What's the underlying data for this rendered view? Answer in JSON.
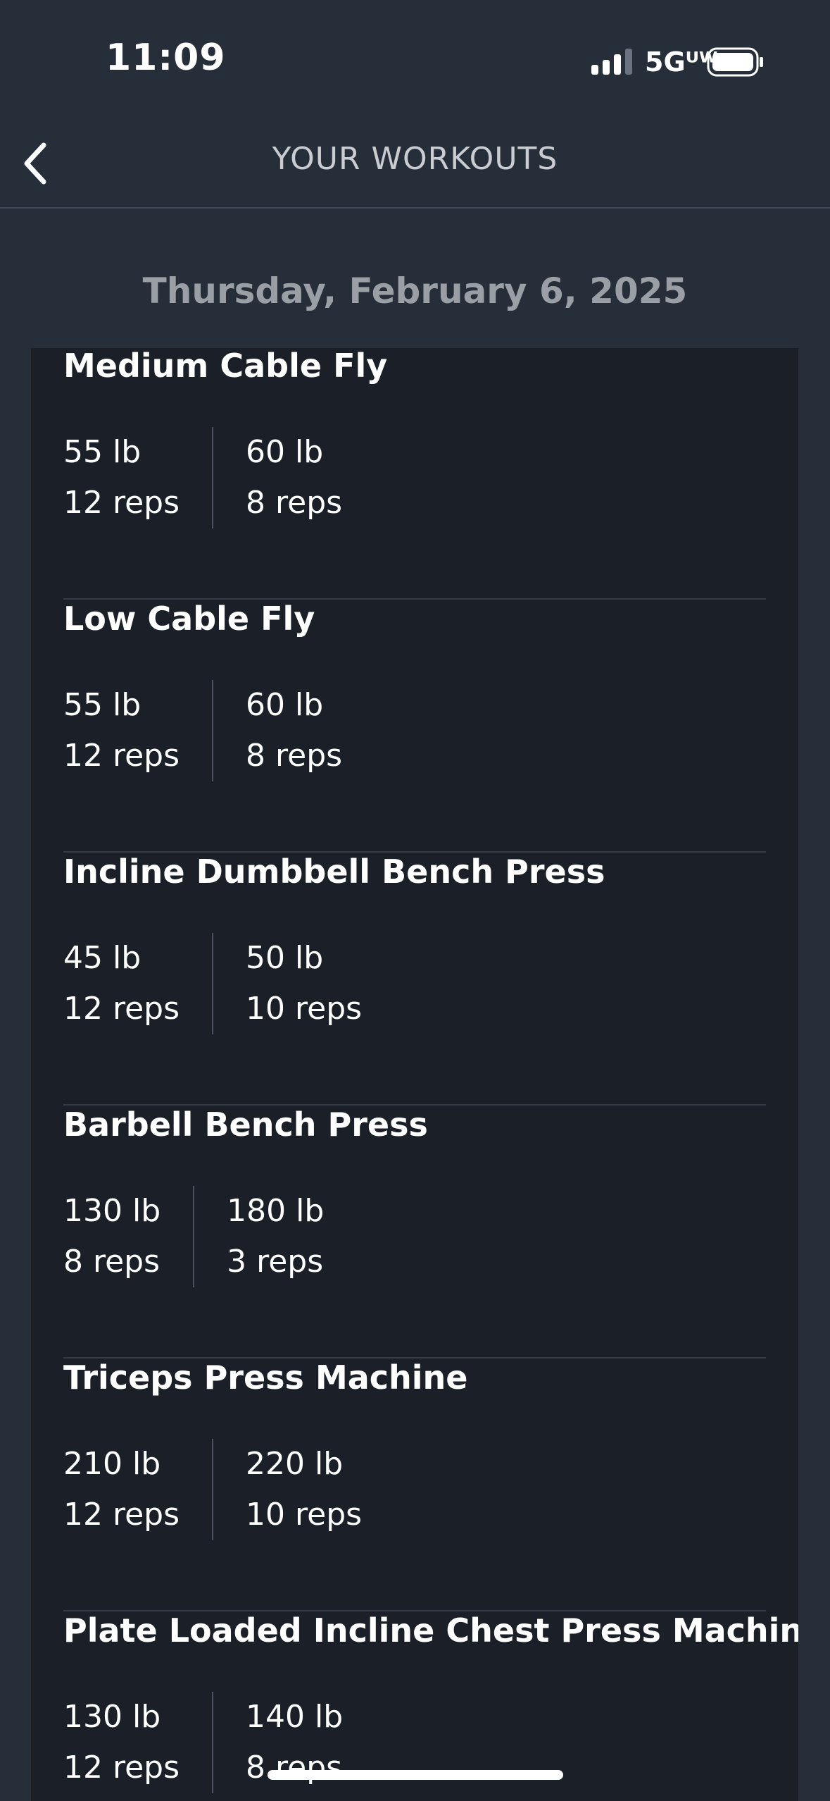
{
  "status_bar": {
    "time": "11:09",
    "network": "5Gᵁᵂ",
    "signal_icon": "signal-bars-icon",
    "battery_icon": "battery-icon"
  },
  "header": {
    "title": "YOUR WORKOUTS",
    "back_icon": "chevron-left-icon"
  },
  "date": "Thursday, February 6, 2025",
  "exercises": [
    {
      "name": "Medium Cable Fly",
      "sets": [
        {
          "weight": "55 lb",
          "reps": "12 reps"
        },
        {
          "weight": "60 lb",
          "reps": "8 reps"
        }
      ]
    },
    {
      "name": "Low Cable Fly",
      "sets": [
        {
          "weight": "55 lb",
          "reps": "12 reps"
        },
        {
          "weight": "60 lb",
          "reps": "8 reps"
        }
      ]
    },
    {
      "name": "Incline Dumbbell Bench Press",
      "sets": [
        {
          "weight": "45 lb",
          "reps": "12 reps"
        },
        {
          "weight": "50 lb",
          "reps": "10 reps"
        }
      ]
    },
    {
      "name": "Barbell Bench Press",
      "sets": [
        {
          "weight": "130 lb",
          "reps": "8 reps"
        },
        {
          "weight": "180 lb",
          "reps": "3 reps"
        }
      ]
    },
    {
      "name": "Triceps Press Machine",
      "sets": [
        {
          "weight": "210 lb",
          "reps": "12 reps"
        },
        {
          "weight": "220 lb",
          "reps": "10 reps"
        }
      ]
    },
    {
      "name": "Plate Loaded Incline Chest Press Machine",
      "sets": [
        {
          "weight": "130 lb",
          "reps": "12 reps"
        },
        {
          "weight": "140 lb",
          "reps": "8 reps"
        }
      ]
    }
  ],
  "colors": {
    "background": "#262e3a",
    "card": "#1b1f27",
    "title_text": "#c9ccd1",
    "date_text": "#9a9ea5"
  }
}
